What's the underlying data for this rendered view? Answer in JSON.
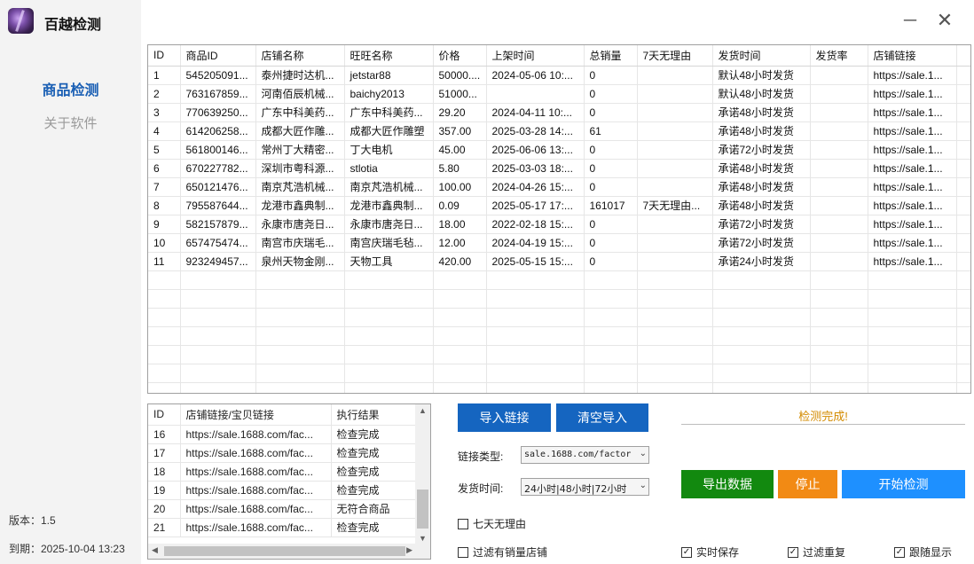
{
  "app": {
    "title": "百越检测",
    "version_label": "版本：1.5",
    "expire_label": "到期：2025-10-04 13:23"
  },
  "nav": {
    "items": [
      {
        "label": "商品检测",
        "active": true
      },
      {
        "label": "关于软件",
        "active": false
      }
    ]
  },
  "window": {
    "minimize": "─",
    "close": "✕"
  },
  "main_table": {
    "columns": [
      "ID",
      "商品ID",
      "店铺名称",
      "旺旺名称",
      "价格",
      "上架时间",
      "总销量",
      "7天无理由",
      "发货时间",
      "发货率",
      "店铺链接"
    ],
    "rows": [
      [
        "1",
        "545205091...",
        "泰州捷时达机...",
        "jetstar88",
        "50000....",
        "2024-05-06 10:...",
        "0",
        "",
        "默认48小时发货",
        "",
        "https://sale.1..."
      ],
      [
        "2",
        "763167859...",
        "河南佰辰机械...",
        "baichy2013",
        "51000...",
        "",
        "0",
        "",
        "默认48小时发货",
        "",
        "https://sale.1..."
      ],
      [
        "3",
        "770639250...",
        "广东中科美药...",
        "广东中科美药...",
        "29.20",
        "2024-04-11 10:...",
        "0",
        "",
        "承诺48小时发货",
        "",
        "https://sale.1..."
      ],
      [
        "4",
        "614206258...",
        "成都大匠作雕...",
        "成都大匠作雕塑",
        "357.00",
        "2025-03-28 14:...",
        "61",
        "",
        "承诺48小时发货",
        "",
        "https://sale.1..."
      ],
      [
        "5",
        "561800146...",
        "常州丁大精密...",
        "丁大电机",
        "45.00",
        "2025-06-06 13:...",
        "0",
        "",
        "承诺72小时发货",
        "",
        "https://sale.1..."
      ],
      [
        "6",
        "670227782...",
        "深圳市粤科源...",
        "stlotia",
        "5.80",
        "2025-03-03 18:...",
        "0",
        "",
        "承诺48小时发货",
        "",
        "https://sale.1..."
      ],
      [
        "7",
        "650121476...",
        "南京芃浩机械...",
        "南京芃浩机械...",
        "100.00",
        "2024-04-26 15:...",
        "0",
        "",
        "承诺48小时发货",
        "",
        "https://sale.1..."
      ],
      [
        "8",
        "795587644...",
        "龙港市鑫典制...",
        "龙港市鑫典制...",
        "0.09",
        "2025-05-17 17:...",
        "161017",
        "7天无理由...",
        "承诺48小时发货",
        "",
        "https://sale.1..."
      ],
      [
        "9",
        "582157879...",
        "永康市唐尧日...",
        "永康市唐尧日...",
        "18.00",
        "2022-02-18 15:...",
        "0",
        "",
        "承诺72小时发货",
        "",
        "https://sale.1..."
      ],
      [
        "10",
        "657475474...",
        "南宫市庆瑞毛...",
        "南宫庆瑞毛毡...",
        "12.00",
        "2024-04-19 15:...",
        "0",
        "",
        "承诺72小时发货",
        "",
        "https://sale.1..."
      ],
      [
        "11",
        "923249457...",
        "泉州天物金刚...",
        "天物工具",
        "420.00",
        "2025-05-15 15:...",
        "0",
        "",
        "承诺24小时发货",
        "",
        "https://sale.1..."
      ]
    ],
    "empty_rows": 7
  },
  "log_table": {
    "columns": [
      "ID",
      "店铺链接/宝贝链接",
      "执行结果"
    ],
    "rows": [
      [
        "16",
        "https://sale.1688.com/fac...",
        "检查完成"
      ],
      [
        "17",
        "https://sale.1688.com/fac...",
        "检查完成"
      ],
      [
        "18",
        "https://sale.1688.com/fac...",
        "检查完成"
      ],
      [
        "19",
        "https://sale.1688.com/fac...",
        "检查完成"
      ],
      [
        "20",
        "https://sale.1688.com/fac...",
        "无符合商品"
      ],
      [
        "21",
        "https://sale.1688.com/fac...",
        "检查完成"
      ]
    ]
  },
  "controls": {
    "import_button": "导入链接",
    "clear_button": "清空导入",
    "link_type_label": "链接类型:",
    "link_type_value": "sale.1688.com/factor",
    "ship_time_label": "发货时间:",
    "ship_time_value": "24小时|48小时|72小时",
    "seven_day_label": "七天无理由",
    "filter_sales_label": "过滤有销量店铺",
    "status_text": "检测完成!",
    "export_button": "导出数据",
    "stop_button": "停止",
    "start_button": "开始检测",
    "realtime_save_label": "实时保存",
    "filter_dup_label": "过滤重复",
    "follow_display_label": "跟随显示",
    "check_mark": "✓"
  },
  "colors": {
    "accent_blue": "#1565c0",
    "export_green": "#12890f",
    "stop_orange": "#f28a14",
    "start_blue": "#1e90ff",
    "status_orange": "#d38b00",
    "nav_active": "#1a5fb4"
  }
}
